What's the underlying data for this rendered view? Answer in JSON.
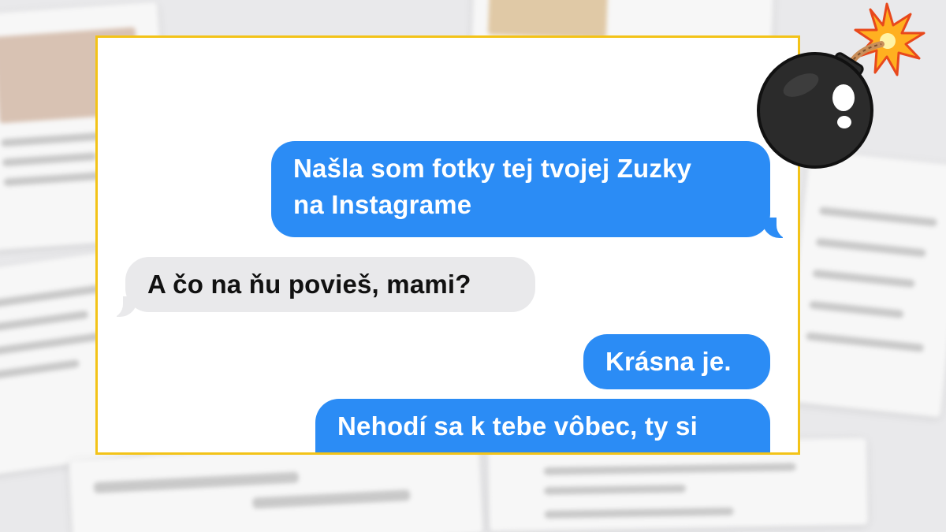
{
  "chat": {
    "messages": [
      {
        "side": "out",
        "line1": "Našla som fotky tej tvojej Zuzky",
        "line2": "na Instagrame"
      },
      {
        "side": "in",
        "text": "A čo na ňu povieš, mami?"
      },
      {
        "side": "out",
        "text": "Krásna je."
      },
      {
        "side": "out",
        "text": "Nehodí sa k tebe vôbec, ty si"
      }
    ]
  },
  "colors": {
    "frame_border": "#f3c318",
    "outgoing_bubble": "#2b8cf5",
    "incoming_bubble": "#e9e9eb"
  },
  "decoration": {
    "icon": "bomb-icon"
  }
}
